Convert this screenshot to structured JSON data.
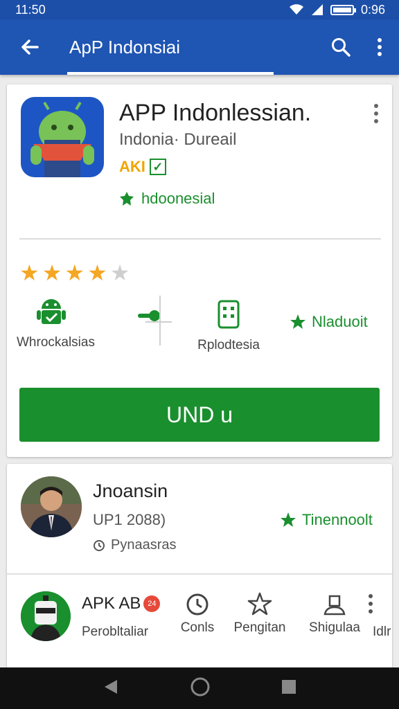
{
  "status": {
    "time": "11:50",
    "clock_right": "0:96"
  },
  "app_bar": {
    "title": "ApP Indonsiai"
  },
  "app": {
    "name": "APP Indonlessian.",
    "developer": "Indonia· Dureail",
    "badge": "AKI",
    "editor_label": "hdoonesial"
  },
  "rating": {
    "filled": 4,
    "total": 5
  },
  "info": {
    "android_label": "Whrockalsias",
    "device_label": "Rplodtesia",
    "rank_label": "Nladuoit"
  },
  "install_button": {
    "label": "UND u"
  },
  "review": {
    "name": "Jnoansin",
    "date": "UP1 2088)",
    "meta": "Pynaasras",
    "rank_label": "Tinennoolt"
  },
  "bottom": {
    "apk_name": "APK AB",
    "notif": "24",
    "apk_sub": "Perobltaliar",
    "actions": [
      {
        "label": "Conls",
        "icon": "timer-icon"
      },
      {
        "label": "Pengitan",
        "icon": "star-outline-icon"
      },
      {
        "label": "Shigulaa",
        "icon": "person-icon"
      }
    ],
    "cut_label": "Idlr"
  },
  "colors": {
    "primary": "#1f55b3",
    "accent_green": "#1a8f2e",
    "star": "#f5a623"
  }
}
